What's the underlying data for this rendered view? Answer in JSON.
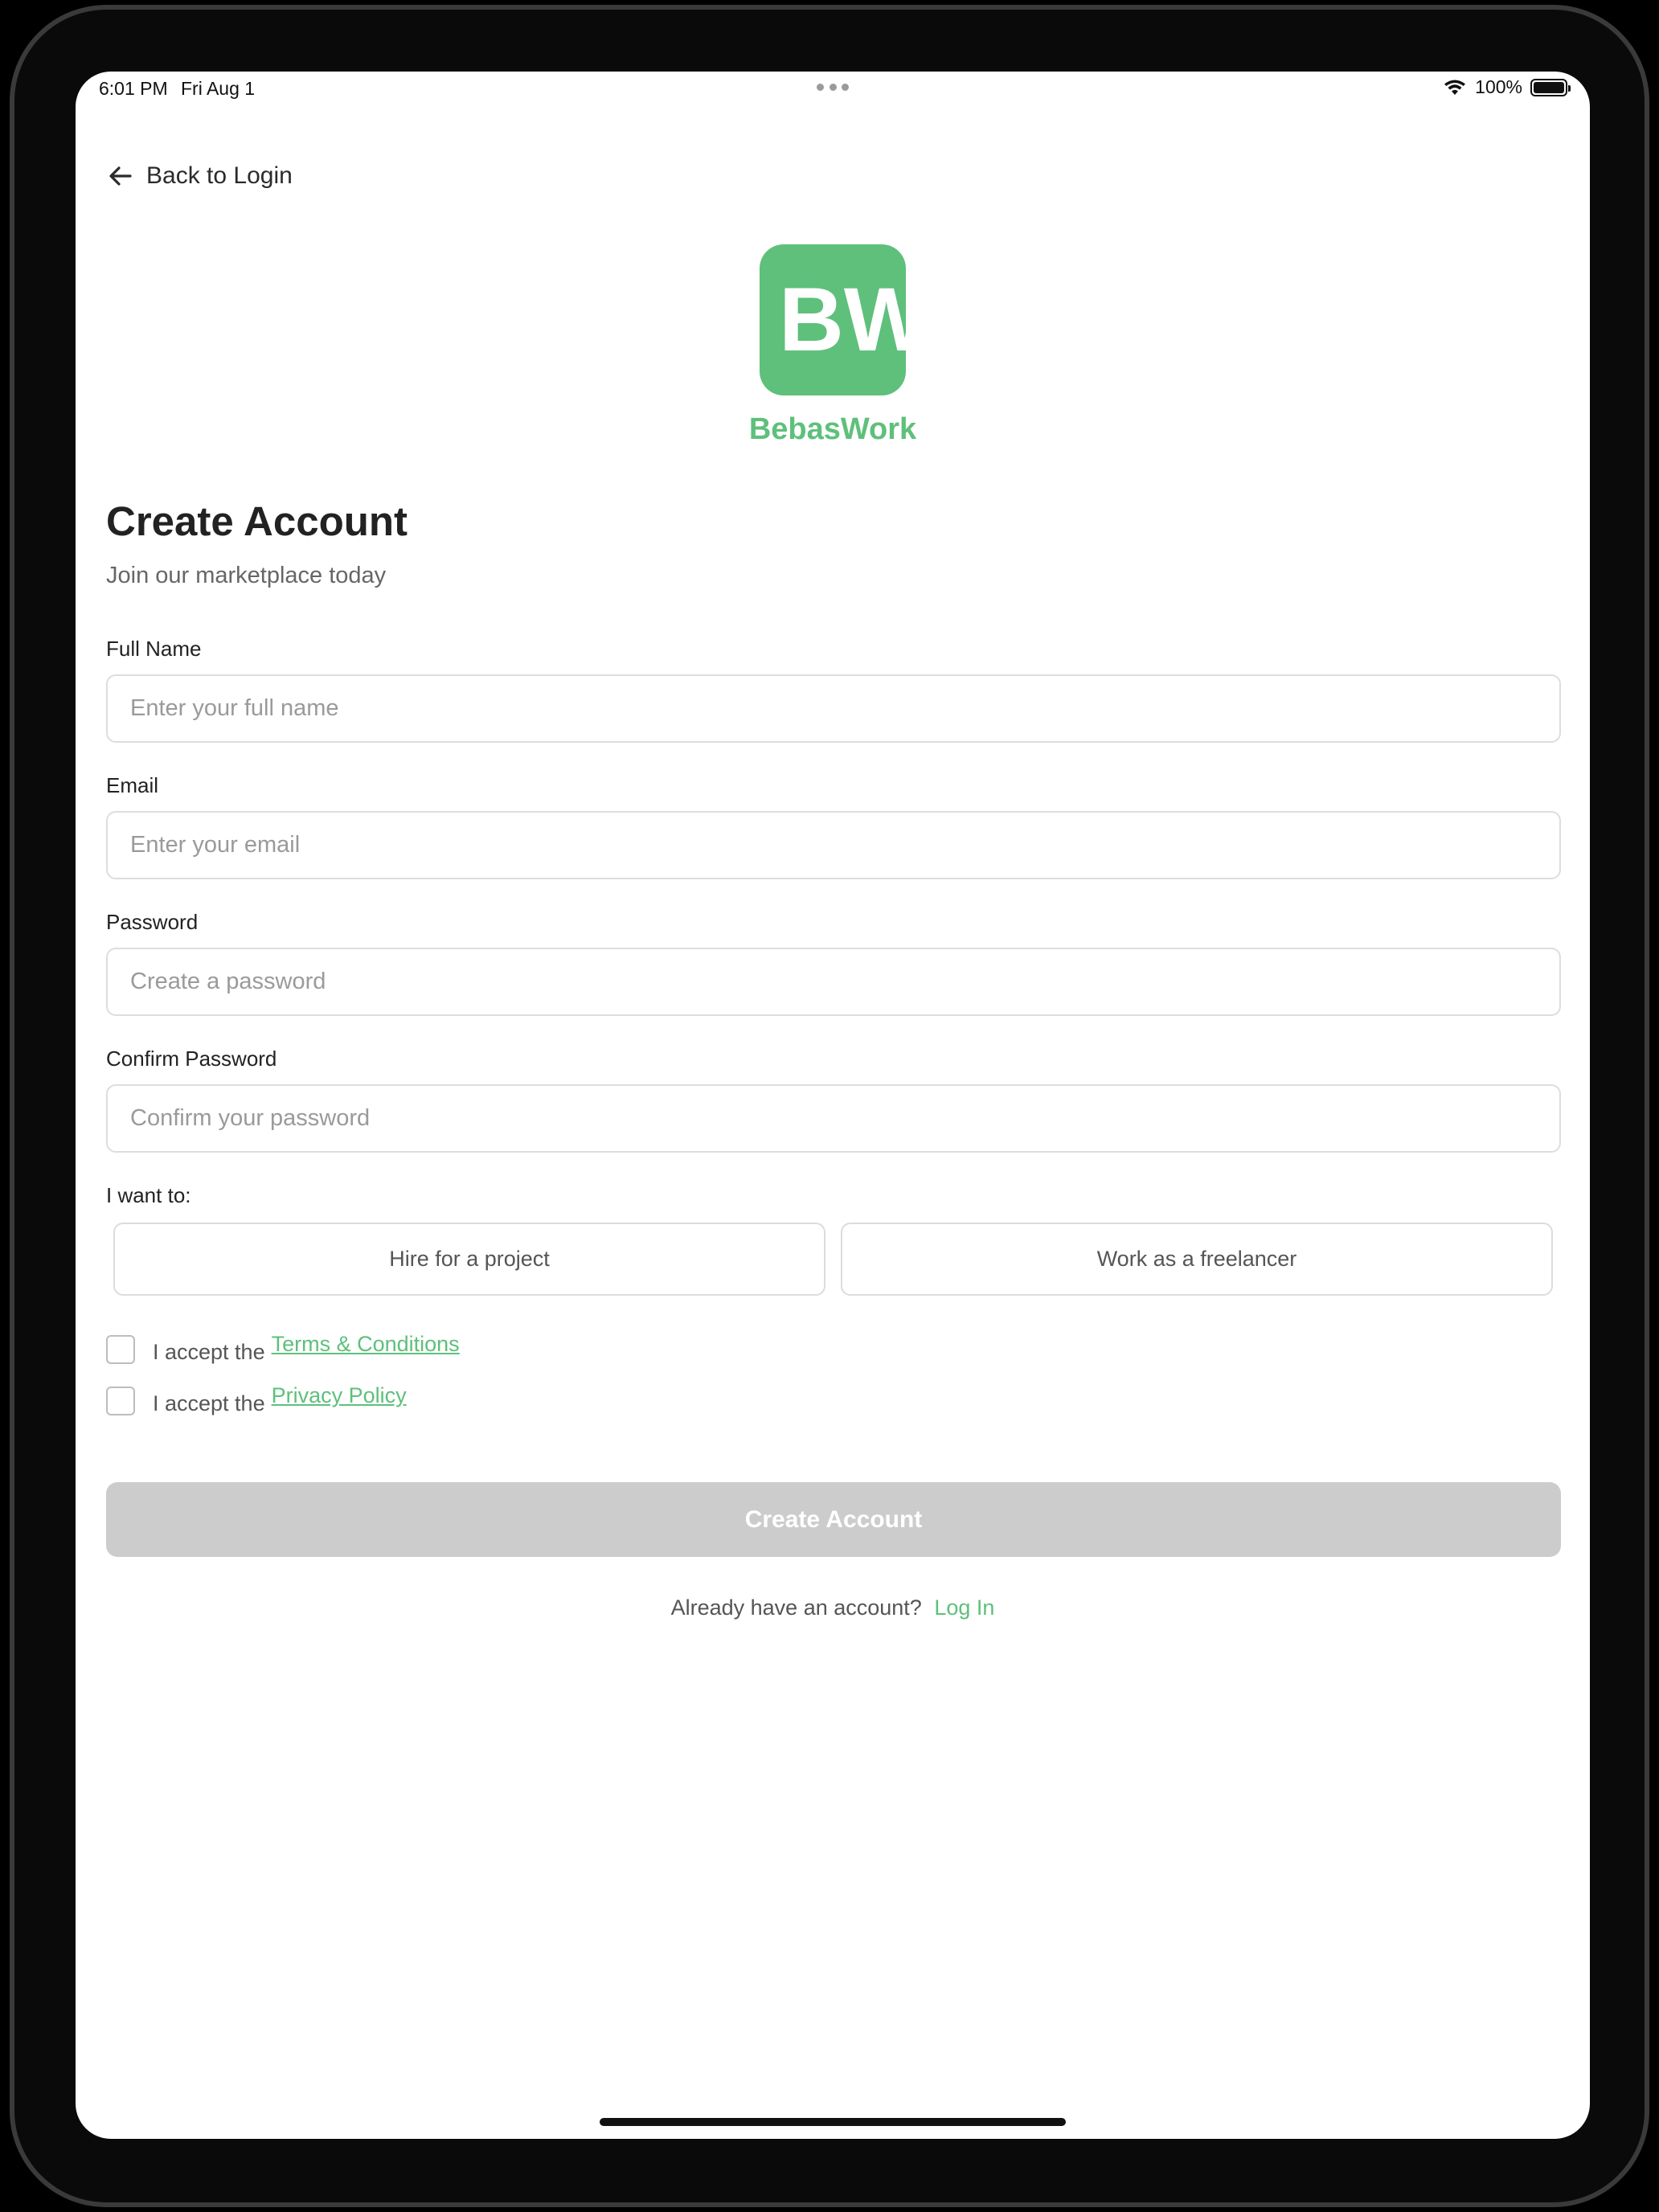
{
  "status_bar": {
    "time": "6:01 PM",
    "date": "Fri Aug 1",
    "battery": "100%"
  },
  "nav": {
    "back_label": "Back to Login"
  },
  "brand": {
    "name": "BebasWork",
    "logo_letters": "BW",
    "color": "#5ec07b"
  },
  "header": {
    "title": "Create Account",
    "subtitle": "Join our marketplace today"
  },
  "form": {
    "full_name": {
      "label": "Full Name",
      "placeholder": "Enter your full name",
      "value": ""
    },
    "email": {
      "label": "Email",
      "placeholder": "Enter your email",
      "value": ""
    },
    "password": {
      "label": "Password",
      "placeholder": "Create a password",
      "value": ""
    },
    "confirm_password": {
      "label": "Confirm Password",
      "placeholder": "Confirm your password",
      "value": ""
    },
    "role": {
      "label": "I want to:",
      "options": [
        "Hire for a project",
        "Work as a freelancer"
      ]
    },
    "terms": {
      "prefix": "I accept the",
      "link": "Terms & Conditions",
      "checked": false
    },
    "privacy": {
      "prefix": "I accept the",
      "link": "Privacy Policy",
      "checked": false
    },
    "submit_label": "Create Account"
  },
  "footer": {
    "prompt": "Already have an account?",
    "link": "Log In"
  }
}
